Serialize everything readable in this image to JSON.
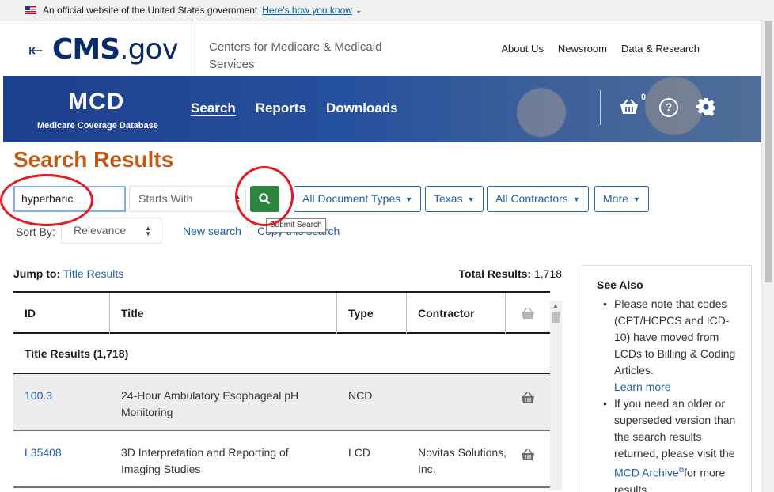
{
  "gov_banner": {
    "text": "An official website of the United States government",
    "link": "Here's how you know"
  },
  "header": {
    "logo_main": "CMS",
    "logo_suffix": ".gov",
    "agency": "Centers for Medicare & Medicaid Services",
    "nav": [
      "About Us",
      "Newsroom",
      "Data & Research"
    ]
  },
  "mcd": {
    "title": "MCD",
    "subtitle": "Medicare Coverage Database",
    "nav": [
      "Search",
      "Reports",
      "Downloads"
    ],
    "active_nav": "Search",
    "cart_count": "0",
    "help_glyph": "?"
  },
  "search": {
    "title": "Search Results",
    "query": "hyperbaric",
    "match_mode": "Starts With",
    "submit_tooltip": "Submit Search",
    "filters": [
      "All Document Types",
      "Texas",
      "All Contractors",
      "More"
    ],
    "sort_label": "Sort By:",
    "sort_value": "Relevance",
    "new_search": "New search",
    "copy_search": "Copy this search"
  },
  "results": {
    "jump_label": "Jump to:",
    "jump_link": "Title Results",
    "total_label": "Total Results:",
    "total_value": "1,718",
    "columns": [
      "ID",
      "Title",
      "Type",
      "Contractor"
    ],
    "group_label": "Title Results (1,718)",
    "rows": [
      {
        "id": "100.3",
        "title": "24-Hour Ambulatory Esophageal pH Monitoring",
        "type": "NCD",
        "contractor": ""
      },
      {
        "id": "L35408",
        "title": "3D Interpretation and Reporting of Imaging Studies",
        "type": "LCD",
        "contractor": "Novitas Solutions, Inc."
      }
    ]
  },
  "see_also": {
    "title": "See Also",
    "item1": "Please note that codes (CPT/HCPCS and ICD-10) have moved from LCDs to Billing & Coding Articles.",
    "item1_link": "Learn more",
    "item2_pre": "If you need an older or superseded version than the search results returned, please visit the",
    "item2_link": "MCD Archive",
    "item2_post": "for more results."
  },
  "colors": {
    "brand": "#0a2b6b",
    "title_orange": "#c05a14",
    "search_green": "#2e8540",
    "link_blue": "#1d5fa8",
    "annotation_red": "#e31b23"
  }
}
